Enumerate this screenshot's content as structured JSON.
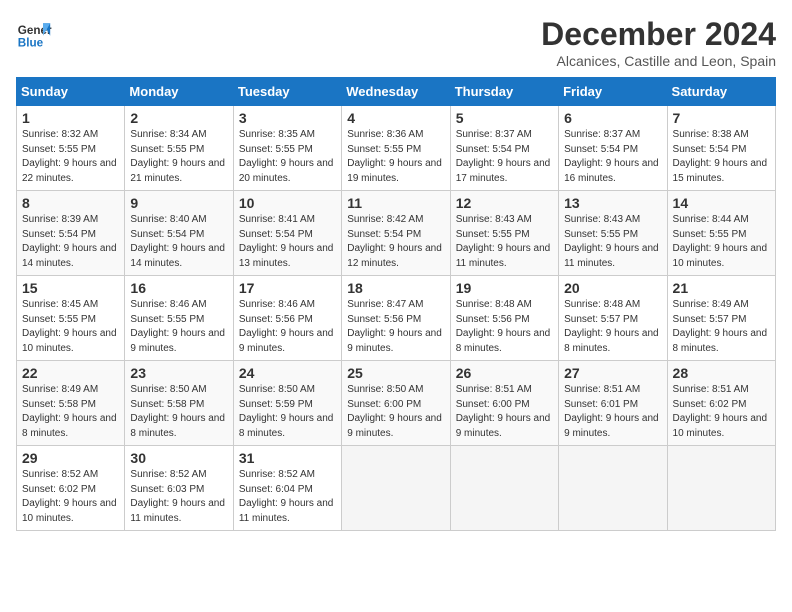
{
  "logo": {
    "line1": "General",
    "line2": "Blue"
  },
  "title": "December 2024",
  "location": "Alcanices, Castille and Leon, Spain",
  "days_of_week": [
    "Sunday",
    "Monday",
    "Tuesday",
    "Wednesday",
    "Thursday",
    "Friday",
    "Saturday"
  ],
  "weeks": [
    [
      {
        "day": 1,
        "sunrise": "8:32 AM",
        "sunset": "5:55 PM",
        "daylight": "9 hours and 22 minutes."
      },
      {
        "day": 2,
        "sunrise": "8:34 AM",
        "sunset": "5:55 PM",
        "daylight": "9 hours and 21 minutes."
      },
      {
        "day": 3,
        "sunrise": "8:35 AM",
        "sunset": "5:55 PM",
        "daylight": "9 hours and 20 minutes."
      },
      {
        "day": 4,
        "sunrise": "8:36 AM",
        "sunset": "5:55 PM",
        "daylight": "9 hours and 19 minutes."
      },
      {
        "day": 5,
        "sunrise": "8:37 AM",
        "sunset": "5:54 PM",
        "daylight": "9 hours and 17 minutes."
      },
      {
        "day": 6,
        "sunrise": "8:37 AM",
        "sunset": "5:54 PM",
        "daylight": "9 hours and 16 minutes."
      },
      {
        "day": 7,
        "sunrise": "8:38 AM",
        "sunset": "5:54 PM",
        "daylight": "9 hours and 15 minutes."
      }
    ],
    [
      {
        "day": 8,
        "sunrise": "8:39 AM",
        "sunset": "5:54 PM",
        "daylight": "9 hours and 14 minutes."
      },
      {
        "day": 9,
        "sunrise": "8:40 AM",
        "sunset": "5:54 PM",
        "daylight": "9 hours and 14 minutes."
      },
      {
        "day": 10,
        "sunrise": "8:41 AM",
        "sunset": "5:54 PM",
        "daylight": "9 hours and 13 minutes."
      },
      {
        "day": 11,
        "sunrise": "8:42 AM",
        "sunset": "5:54 PM",
        "daylight": "9 hours and 12 minutes."
      },
      {
        "day": 12,
        "sunrise": "8:43 AM",
        "sunset": "5:55 PM",
        "daylight": "9 hours and 11 minutes."
      },
      {
        "day": 13,
        "sunrise": "8:43 AM",
        "sunset": "5:55 PM",
        "daylight": "9 hours and 11 minutes."
      },
      {
        "day": 14,
        "sunrise": "8:44 AM",
        "sunset": "5:55 PM",
        "daylight": "9 hours and 10 minutes."
      }
    ],
    [
      {
        "day": 15,
        "sunrise": "8:45 AM",
        "sunset": "5:55 PM",
        "daylight": "9 hours and 10 minutes."
      },
      {
        "day": 16,
        "sunrise": "8:46 AM",
        "sunset": "5:55 PM",
        "daylight": "9 hours and 9 minutes."
      },
      {
        "day": 17,
        "sunrise": "8:46 AM",
        "sunset": "5:56 PM",
        "daylight": "9 hours and 9 minutes."
      },
      {
        "day": 18,
        "sunrise": "8:47 AM",
        "sunset": "5:56 PM",
        "daylight": "9 hours and 9 minutes."
      },
      {
        "day": 19,
        "sunrise": "8:48 AM",
        "sunset": "5:56 PM",
        "daylight": "9 hours and 8 minutes."
      },
      {
        "day": 20,
        "sunrise": "8:48 AM",
        "sunset": "5:57 PM",
        "daylight": "9 hours and 8 minutes."
      },
      {
        "day": 21,
        "sunrise": "8:49 AM",
        "sunset": "5:57 PM",
        "daylight": "9 hours and 8 minutes."
      }
    ],
    [
      {
        "day": 22,
        "sunrise": "8:49 AM",
        "sunset": "5:58 PM",
        "daylight": "9 hours and 8 minutes."
      },
      {
        "day": 23,
        "sunrise": "8:50 AM",
        "sunset": "5:58 PM",
        "daylight": "9 hours and 8 minutes."
      },
      {
        "day": 24,
        "sunrise": "8:50 AM",
        "sunset": "5:59 PM",
        "daylight": "9 hours and 8 minutes."
      },
      {
        "day": 25,
        "sunrise": "8:50 AM",
        "sunset": "6:00 PM",
        "daylight": "9 hours and 9 minutes."
      },
      {
        "day": 26,
        "sunrise": "8:51 AM",
        "sunset": "6:00 PM",
        "daylight": "9 hours and 9 minutes."
      },
      {
        "day": 27,
        "sunrise": "8:51 AM",
        "sunset": "6:01 PM",
        "daylight": "9 hours and 9 minutes."
      },
      {
        "day": 28,
        "sunrise": "8:51 AM",
        "sunset": "6:02 PM",
        "daylight": "9 hours and 10 minutes."
      }
    ],
    [
      {
        "day": 29,
        "sunrise": "8:52 AM",
        "sunset": "6:02 PM",
        "daylight": "9 hours and 10 minutes."
      },
      {
        "day": 30,
        "sunrise": "8:52 AM",
        "sunset": "6:03 PM",
        "daylight": "9 hours and 11 minutes."
      },
      {
        "day": 31,
        "sunrise": "8:52 AM",
        "sunset": "6:04 PM",
        "daylight": "9 hours and 11 minutes."
      },
      null,
      null,
      null,
      null
    ]
  ]
}
